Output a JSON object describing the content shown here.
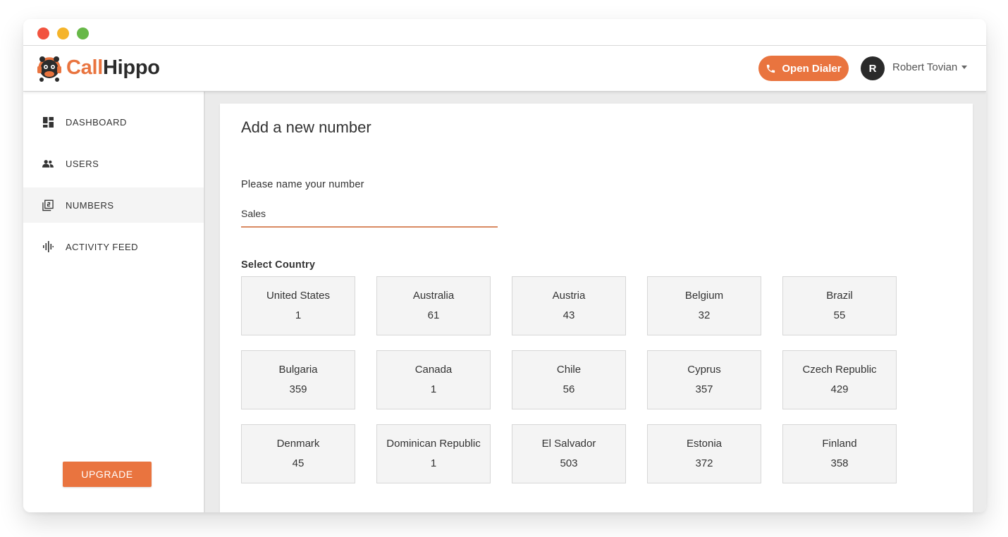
{
  "app": {
    "brand_call": "Call",
    "brand_hippo": "Hippo"
  },
  "header": {
    "dialer_label": "Open Dialer",
    "user_initial": "R",
    "user_name": "Robert Tovian"
  },
  "sidebar": {
    "items": [
      {
        "label": "DASHBOARD",
        "icon": "dashboard-icon"
      },
      {
        "label": "USERS",
        "icon": "users-icon"
      },
      {
        "label": "NUMBERS",
        "icon": "numbers-icon",
        "active": true
      },
      {
        "label": "ACTIVITY FEED",
        "icon": "activity-icon"
      }
    ],
    "upgrade_label": "UPGRADE"
  },
  "main": {
    "title": "Add a new number",
    "name_label": "Please name your number",
    "name_value": "Sales",
    "country_label": "Select Country",
    "countries": [
      {
        "name": "United States",
        "code": "1"
      },
      {
        "name": "Australia",
        "code": "61"
      },
      {
        "name": "Austria",
        "code": "43"
      },
      {
        "name": "Belgium",
        "code": "32"
      },
      {
        "name": "Brazil",
        "code": "55"
      },
      {
        "name": "Bulgaria",
        "code": "359"
      },
      {
        "name": "Canada",
        "code": "1"
      },
      {
        "name": "Chile",
        "code": "56"
      },
      {
        "name": "Cyprus",
        "code": "357"
      },
      {
        "name": "Czech Republic",
        "code": "429"
      },
      {
        "name": "Denmark",
        "code": "45"
      },
      {
        "name": "Dominican Republic",
        "code": "1"
      },
      {
        "name": "El Salvador",
        "code": "503"
      },
      {
        "name": "Estonia",
        "code": "372"
      },
      {
        "name": "Finland",
        "code": "358"
      }
    ]
  },
  "colors": {
    "accent": "#e9743f",
    "dark": "#2b2b2b",
    "tile_bg": "#f4f4f4"
  }
}
